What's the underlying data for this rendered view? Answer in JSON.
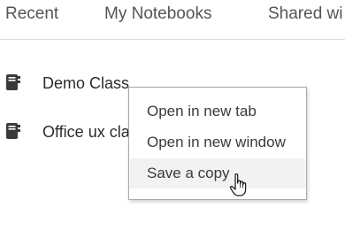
{
  "tabs": [
    {
      "label": "Recent"
    },
    {
      "label": "My Notebooks"
    },
    {
      "label": "Shared wi"
    }
  ],
  "notebooks": [
    {
      "name": "Demo Class",
      "icon": "notebook-icon"
    },
    {
      "name": "Office ux cla",
      "icon": "notebook-icon"
    }
  ],
  "context_menu": {
    "items": [
      {
        "label": "Open in new tab"
      },
      {
        "label": "Open in new window"
      },
      {
        "label": "Save a copy",
        "hovered": true
      }
    ]
  },
  "cursor": {
    "icon": "hand-pointer-icon"
  },
  "colors": {
    "text": "#333333",
    "menu_border": "#a8a8a8",
    "hover_bg": "#f2f2f2",
    "divider": "#dcdcdc"
  }
}
